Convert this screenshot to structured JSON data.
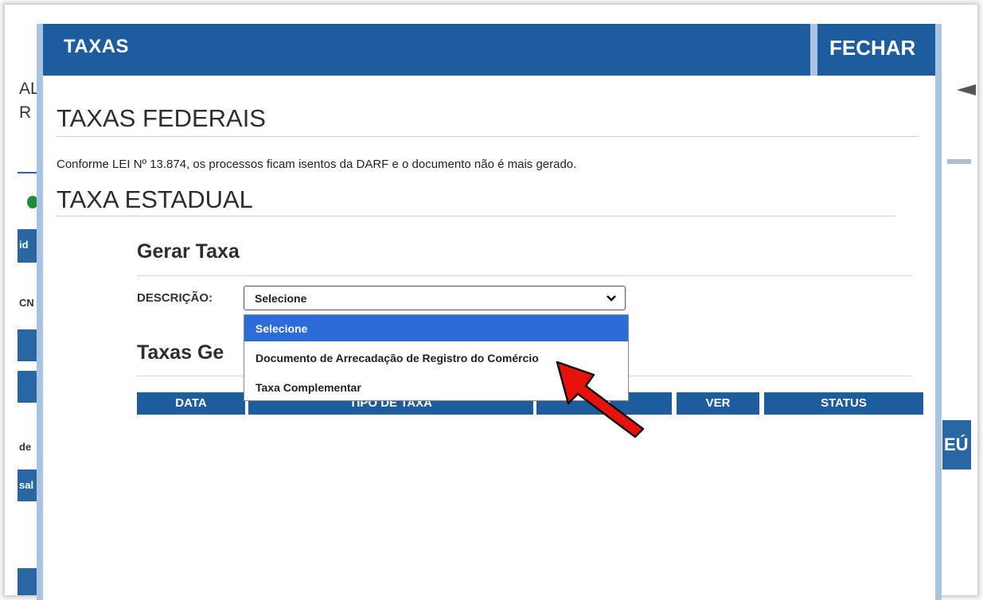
{
  "modal": {
    "title": "TAXAS",
    "close_label": "FECHAR"
  },
  "federal": {
    "heading": "TAXAS FEDERAIS",
    "notice": "Conforme LEI Nº 13.874, os processos ficam isentos da DARF e o documento não é mais gerado."
  },
  "estadual": {
    "heading": "TAXA ESTADUAL"
  },
  "gerar": {
    "heading": "Gerar Taxa",
    "label": "DESCRIÇÃO:",
    "selected": "Selecione",
    "options": [
      "Selecione",
      "Documento de Arrecadação de Registro do Comércio",
      "Taxa Complementar"
    ]
  },
  "geradas": {
    "heading": "Taxas Ge",
    "columns": [
      "DATA",
      "TIPO DE TAXA",
      "VA",
      "VER",
      "STATUS"
    ]
  },
  "background": {
    "frag1": "AL",
    "frag2": "R",
    "frag3": "id",
    "frag4": "CN",
    "frag5": "de",
    "frag6": "sal",
    "frag7": "EÚ"
  },
  "colors": {
    "header_blue": "#1d5d9e",
    "selected_option": "#2b6cd8",
    "arrow_red": "#e8120c"
  },
  "icons": {
    "dropdown": "chevron-down-icon",
    "annotation": "red-arrow-icon"
  }
}
